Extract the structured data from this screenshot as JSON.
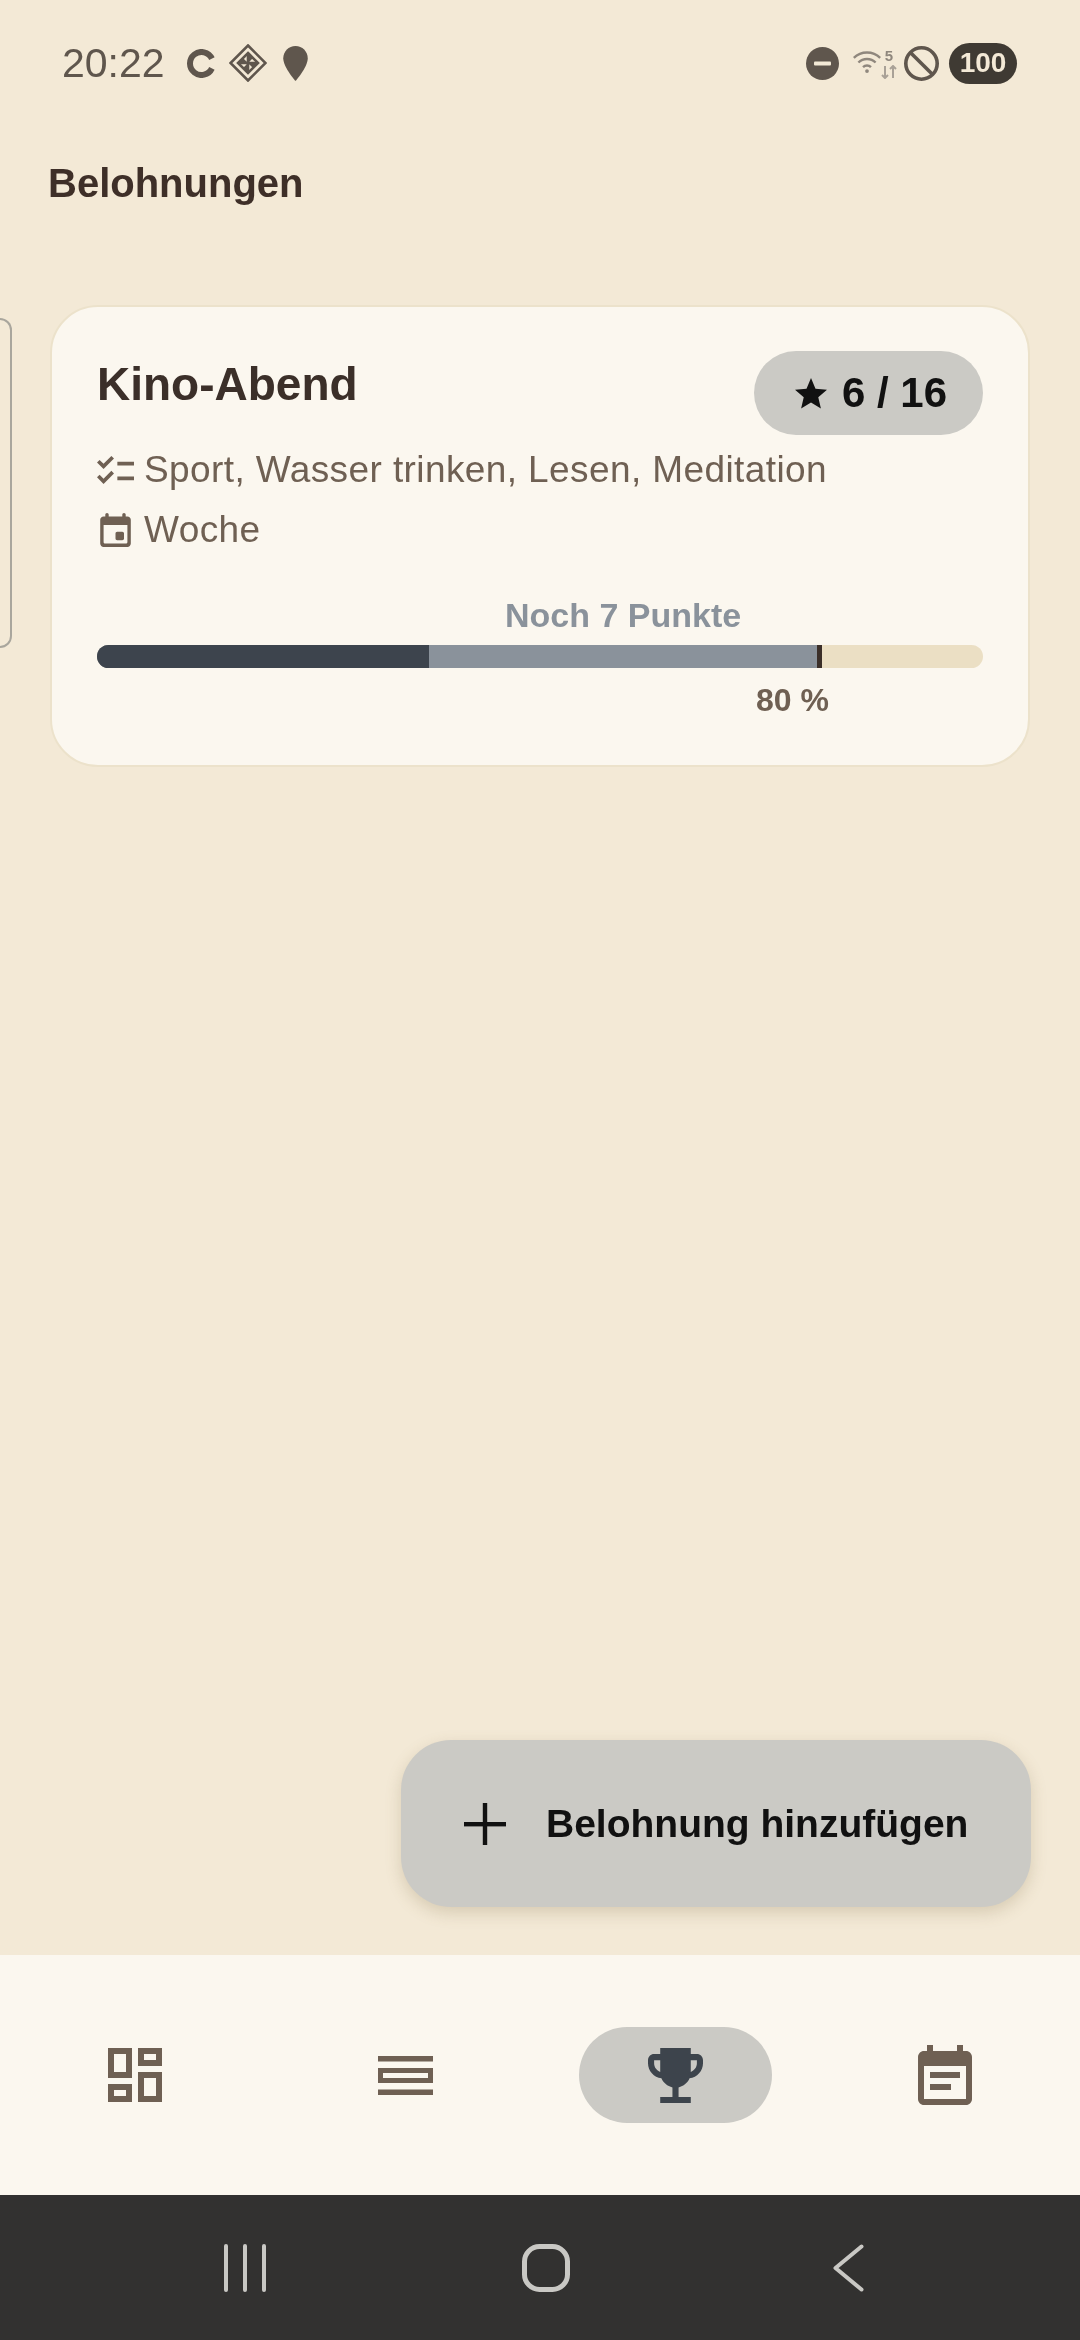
{
  "status_bar": {
    "time": "20:22",
    "wifi_label": "5",
    "battery": "100"
  },
  "app_bar": {
    "title": "Belohnungen"
  },
  "rewards": [
    {
      "title": "Kino-Abend",
      "points": "6 / 16",
      "details": [
        {
          "kind": "habits",
          "text": "Sport, Wasser trinken, Lesen, Meditation"
        },
        {
          "kind": "period",
          "text": "Woche"
        }
      ],
      "progress": {
        "level": 0.375,
        "remaining": "Noch 7 Punkte",
        "goal": {
          "level": 0.8125,
          "label": "80 %"
        }
      }
    }
  ],
  "fab": {
    "label": "Belohnung hinzufügen"
  },
  "bottom_nav": [
    {
      "kind": "dashboard",
      "selected": false
    },
    {
      "kind": "list",
      "selected": false
    },
    {
      "kind": "trophy",
      "selected": true
    },
    {
      "kind": "calendar",
      "selected": false
    }
  ]
}
